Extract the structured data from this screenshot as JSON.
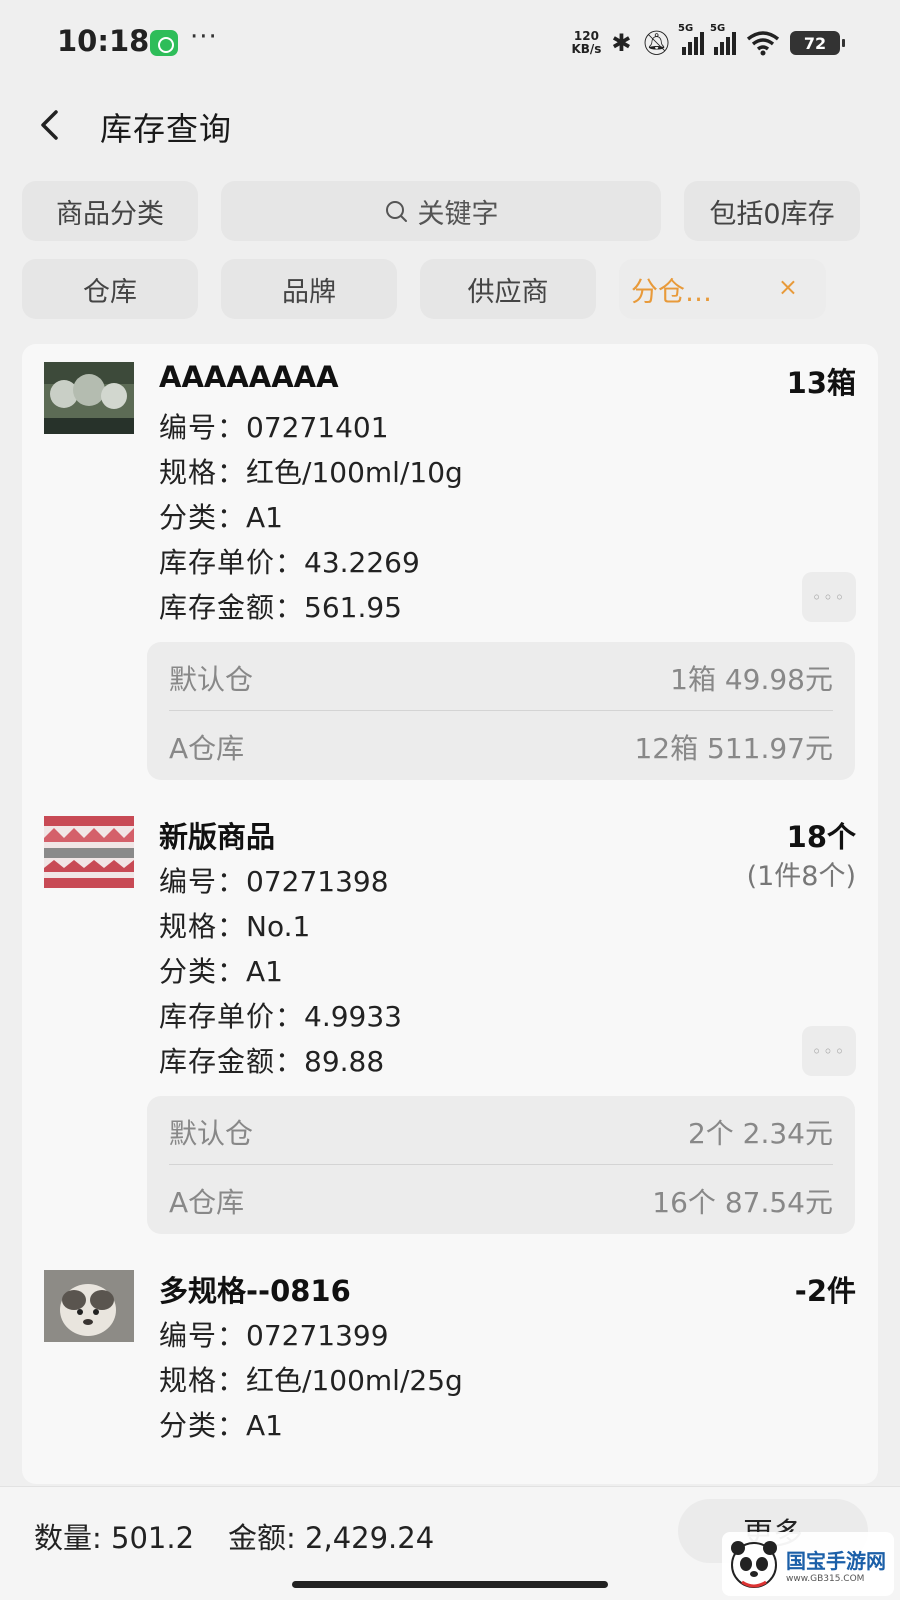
{
  "status_bar": {
    "time": "10:18",
    "more": "···",
    "speed_value": "120",
    "speed_unit": "KB/s",
    "network_1": "5G",
    "network_2": "5G",
    "battery": "72",
    "icons": [
      "app-notification-icon",
      "bluetooth-icon",
      "mute-bell-icon",
      "signal-icon",
      "wifi-icon",
      "battery-icon"
    ]
  },
  "header": {
    "title": "库存查询",
    "back_icon": "chevron-left-icon"
  },
  "filters": {
    "row1": {
      "category": "商品分类",
      "search_placeholder": "关键字",
      "include_zero": "包括0库存"
    },
    "row2": {
      "warehouse": "仓库",
      "brand": "品牌",
      "supplier": "供应商",
      "split_warehouse": "分仓…",
      "clear": "×"
    },
    "active_color": "#e89a3a"
  },
  "labels": {
    "code": "编号：",
    "spec": "规格：",
    "category": "分类：",
    "unit_price": "库存单价：",
    "amount": "库存金额："
  },
  "items": [
    {
      "name": "AAAAAAAA",
      "qty": "13箱",
      "code": "07271401",
      "spec": "红色/100ml/10g",
      "category": "A1",
      "unit_price": "43.2269",
      "amount": "561.95",
      "more": "◦◦◦",
      "warehouses": [
        {
          "name": "默认仓",
          "value": "1箱 49.98元"
        },
        {
          "name": "A仓库",
          "value": "12箱 511.97元"
        }
      ]
    },
    {
      "name": "新版商品",
      "qty": "18个",
      "qty_detail": "(1件8个)",
      "code": "07271398",
      "spec": "No.1",
      "category": "A1",
      "unit_price": "4.9933",
      "amount": "89.88",
      "more": "◦◦◦",
      "warehouses": [
        {
          "name": "默认仓",
          "value": "2个 2.34元"
        },
        {
          "name": "A仓库",
          "value": "16个 87.54元"
        }
      ]
    },
    {
      "name": "多规格--0816",
      "qty": "-2件",
      "code": "07271399",
      "spec": "红色/100ml/25g",
      "category": "A1"
    }
  ],
  "bottom_bar": {
    "qty_label": "数量: ",
    "qty_value": "501.2",
    "amount_label": "金额: ",
    "amount_value": "2,429.24",
    "more_button": "更多"
  },
  "watermark": {
    "name": "国宝手游网",
    "url": "www.GB315.COM"
  }
}
